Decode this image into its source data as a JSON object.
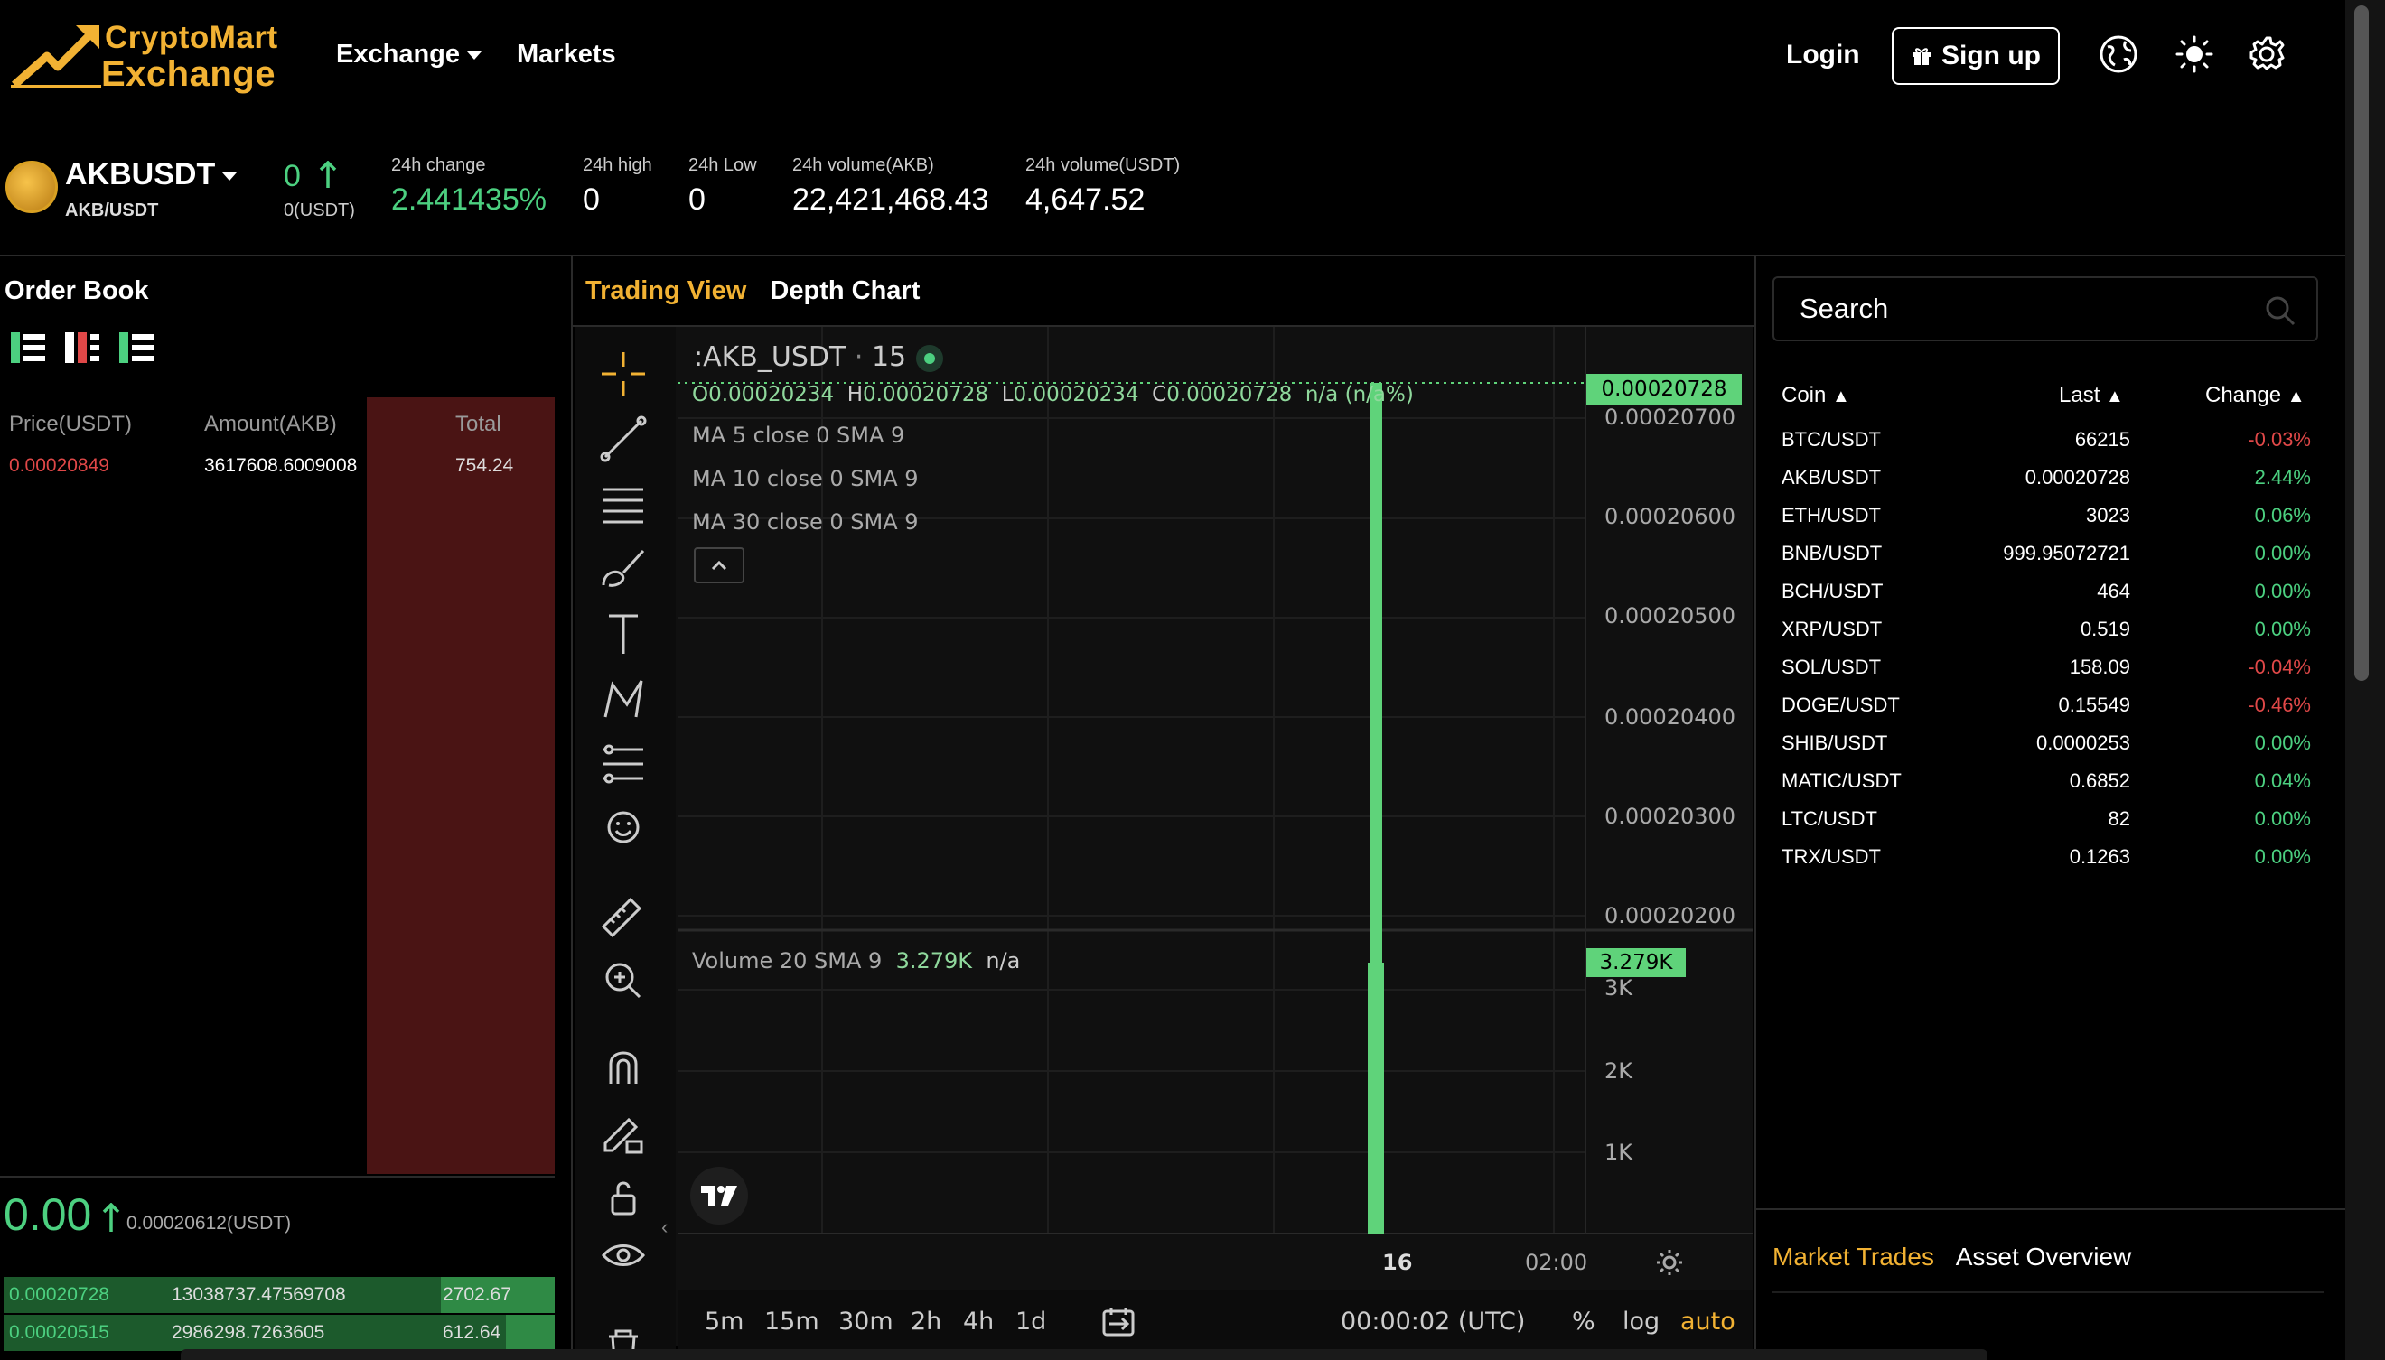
{
  "brand": {
    "line1": "CryptoMart",
    "line2": "Exchange"
  },
  "nav": {
    "exchange": "Exchange",
    "markets": "Markets"
  },
  "header": {
    "login": "Login",
    "signup": "Sign up"
  },
  "ticker": {
    "pair": "AKBUSDT",
    "pair_sub": "AKB/USDT",
    "price": "0",
    "price_sub": "0(USDT)",
    "stats": [
      {
        "label": "24h change",
        "value": "2.441435%"
      },
      {
        "label": "24h high",
        "value": "0"
      },
      {
        "label": "24h Low",
        "value": "0"
      },
      {
        "label": "24h volume(AKB)",
        "value": "22,421,468.43"
      },
      {
        "label": "24h volume(USDT)",
        "value": "4,647.52"
      }
    ]
  },
  "orderbook": {
    "title": "Order Book",
    "headers": [
      "Price(USDT)",
      "Amount(AKB)",
      "Total"
    ],
    "asks": [
      {
        "price": "0.00020849",
        "amount": "3617608.6009008",
        "total": "754.24"
      }
    ],
    "last_price": "0.00",
    "last_price_sub": "0.00020612(USDT)",
    "bids": [
      {
        "price": "0.00020728",
        "amount": "13038737.47569708",
        "total": "2702.67"
      },
      {
        "price": "0.00020515",
        "amount": "2986298.7263605",
        "total": "612.64"
      }
    ]
  },
  "chart": {
    "tabs": [
      "Trading View",
      "Depth Chart"
    ],
    "symbol": ":AKB_USDT",
    "interval": "15",
    "ohlc": {
      "o": "0.00020234",
      "h": "0.00020728",
      "l": "0.00020234",
      "c": "0.00020728",
      "extra": "n/a (n/a%)"
    },
    "ma": [
      "MA 5 close 0 SMA 9",
      "MA 10 close 0 SMA 9",
      "MA 30 close 0 SMA 9"
    ],
    "price_tag": "0.00020728",
    "y_ticks": [
      "0.00020700",
      "0.00020600",
      "0.00020500",
      "0.00020400",
      "0.00020300",
      "0.00020200"
    ],
    "volume_label": "Volume 20 SMA 9",
    "volume_value": "3.279K",
    "volume_extra": "n/a",
    "volume_tag": "3.279K",
    "vol_ticks": [
      "3K",
      "2K",
      "1K"
    ],
    "x_ticks": [
      "16",
      "02:00"
    ],
    "timeframes": [
      "5m",
      "15m",
      "30m",
      "2h",
      "4h",
      "1d"
    ],
    "clock": "00:00:02 (UTC)",
    "scale_opts": [
      "%",
      "log",
      "auto"
    ]
  },
  "markets": {
    "search_placeholder": "Search",
    "headers": [
      "Coin",
      "Last",
      "Change"
    ],
    "rows": [
      {
        "coin": "BTC/USDT",
        "last": "66215",
        "change": "-0.03%",
        "dir": "down"
      },
      {
        "coin": "AKB/USDT",
        "last": "0.00020728",
        "change": "2.44%",
        "dir": "up"
      },
      {
        "coin": "ETH/USDT",
        "last": "3023",
        "change": "0.06%",
        "dir": "up"
      },
      {
        "coin": "BNB/USDT",
        "last": "999.95072721",
        "change": "0.00%",
        "dir": "up"
      },
      {
        "coin": "BCH/USDT",
        "last": "464",
        "change": "0.00%",
        "dir": "up"
      },
      {
        "coin": "XRP/USDT",
        "last": "0.519",
        "change": "0.00%",
        "dir": "up"
      },
      {
        "coin": "SOL/USDT",
        "last": "158.09",
        "change": "-0.04%",
        "dir": "down"
      },
      {
        "coin": "DOGE/USDT",
        "last": "0.15549",
        "change": "-0.46%",
        "dir": "down"
      },
      {
        "coin": "SHIB/USDT",
        "last": "0.0000253",
        "change": "0.00%",
        "dir": "up"
      },
      {
        "coin": "MATIC/USDT",
        "last": "0.6852",
        "change": "0.04%",
        "dir": "up"
      },
      {
        "coin": "LTC/USDT",
        "last": "82",
        "change": "0.00%",
        "dir": "up"
      },
      {
        "coin": "TRX/USDT",
        "last": "0.1263",
        "change": "0.00%",
        "dir": "up"
      }
    ],
    "bottom_tabs": [
      "Market Trades",
      "Asset Overview"
    ]
  },
  "colors": {
    "accent": "#f2b233",
    "up": "#4cd080",
    "down": "#e04848",
    "candle": "#5fd37a"
  }
}
